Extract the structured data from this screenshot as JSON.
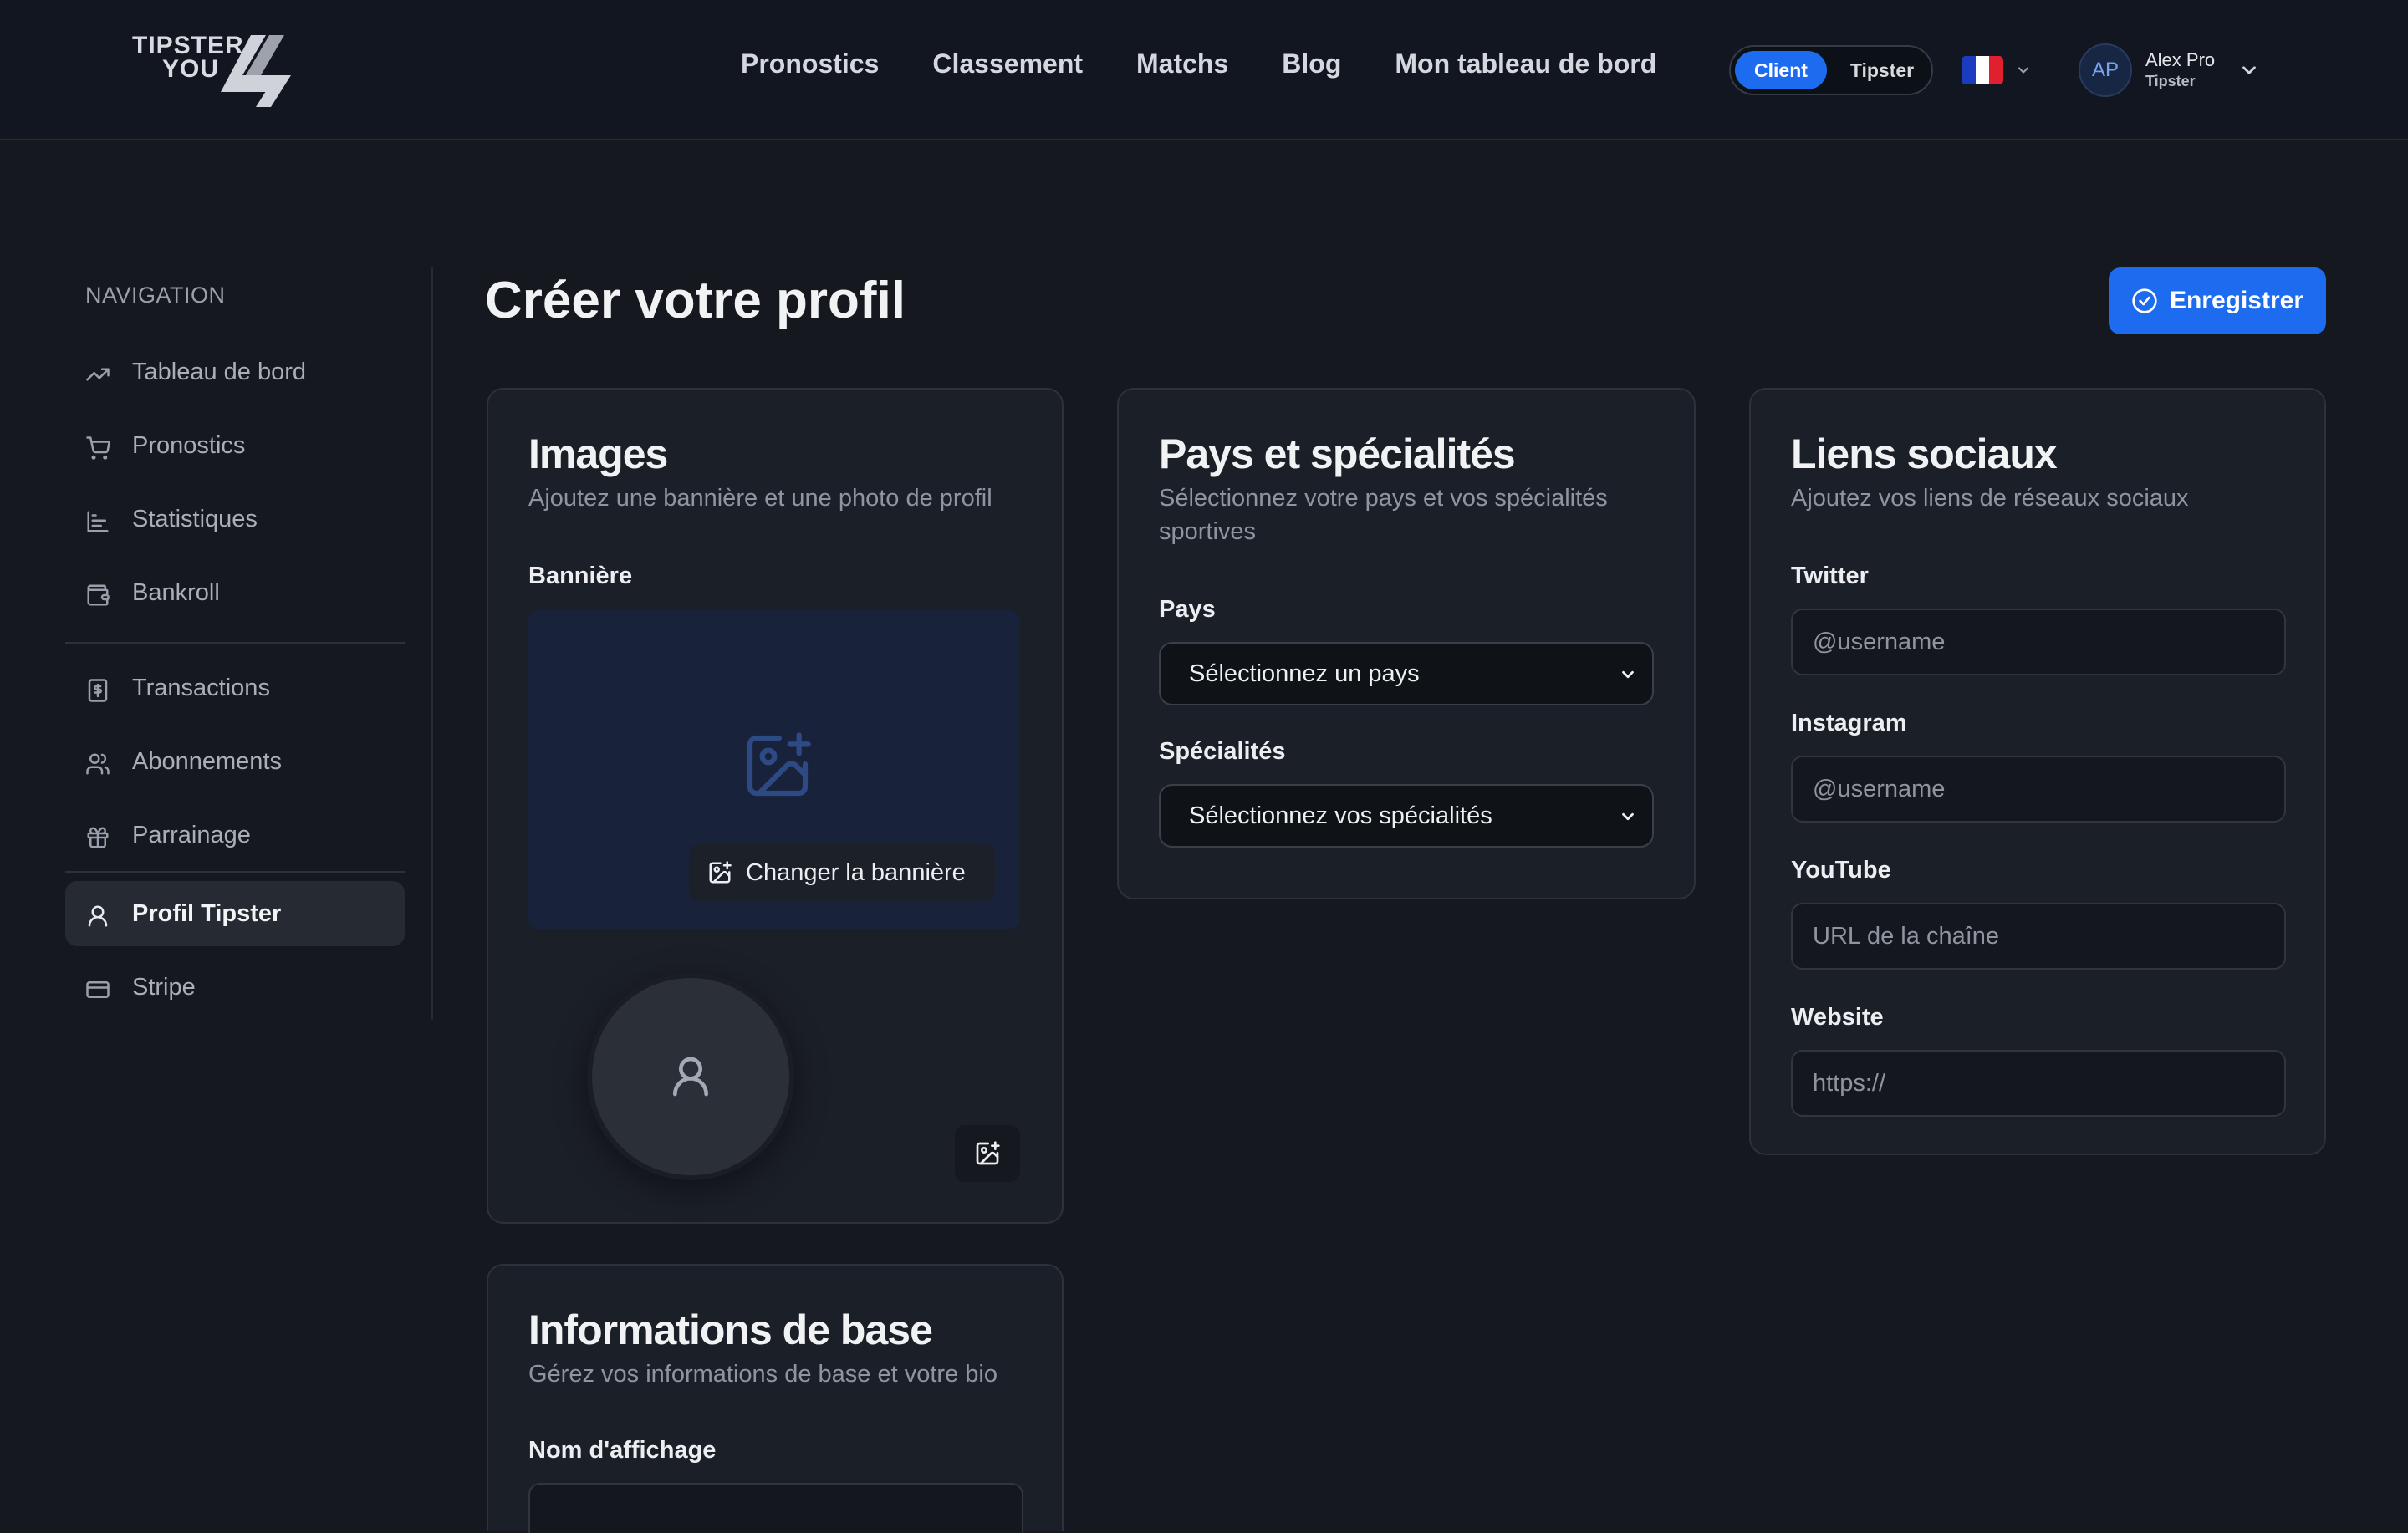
{
  "brand": {
    "logo_line1": "TIPSTER",
    "logo_line2": "YOU"
  },
  "nav": {
    "links": [
      "Pronostics",
      "Classement",
      "Matchs",
      "Blog",
      "Mon tableau de bord"
    ]
  },
  "role_toggle": {
    "active": "Client",
    "inactive": "Tipster"
  },
  "language": {
    "flag": "fr-flag-icon",
    "flag_colors": [
      "#1b3cbf",
      "#ffffff",
      "#e0202e"
    ]
  },
  "user": {
    "initials": "AP",
    "name": "Alex Pro",
    "role": "Tipster"
  },
  "sidebar": {
    "heading": "NAVIGATION",
    "items": [
      {
        "label": "Tableau de bord",
        "icon": "trending-up-icon"
      },
      {
        "label": "Pronostics",
        "icon": "cart-icon"
      },
      {
        "label": "Statistiques",
        "icon": "bar-chart-icon"
      },
      {
        "label": "Bankroll",
        "icon": "wallet-icon"
      },
      {
        "label": "Transactions",
        "icon": "receipt-icon"
      },
      {
        "label": "Abonnements",
        "icon": "users-icon"
      },
      {
        "label": "Parrainage",
        "icon": "gift-icon"
      },
      {
        "label": "Profil Tipster",
        "icon": "user-icon",
        "active": true
      },
      {
        "label": "Stripe",
        "icon": "credit-card-icon"
      }
    ]
  },
  "page": {
    "title": "Créer votre profil",
    "save_label": "Enregistrer"
  },
  "images_card": {
    "title": "Images",
    "subtitle": "Ajoutez une bannière et une photo de profil",
    "banner_label": "Bannière",
    "change_banner_label": "Changer la bannière"
  },
  "country_card": {
    "title": "Pays et spécialités",
    "subtitle": "Sélectionnez votre pays et vos spécialités sportives",
    "country_label": "Pays",
    "country_value": "Sélectionnez un pays",
    "specialties_label": "Spécialités",
    "specialties_value": "Sélectionnez vos spécialités"
  },
  "social_card": {
    "title": "Liens sociaux",
    "subtitle": "Ajoutez vos liens de réseaux sociaux",
    "fields": [
      {
        "label": "Twitter",
        "placeholder": "@username"
      },
      {
        "label": "Instagram",
        "placeholder": "@username"
      },
      {
        "label": "YouTube",
        "placeholder": "URL de la chaîne"
      },
      {
        "label": "Website",
        "placeholder": "https://"
      }
    ]
  },
  "basic_info_card": {
    "title": "Informations de base",
    "subtitle": "Gérez vos informations de base et votre bio",
    "display_name_label": "Nom d'affichage"
  },
  "colors": {
    "accent": "#1d6cf0",
    "background": "#15181e",
    "card": "#1b1f27"
  }
}
